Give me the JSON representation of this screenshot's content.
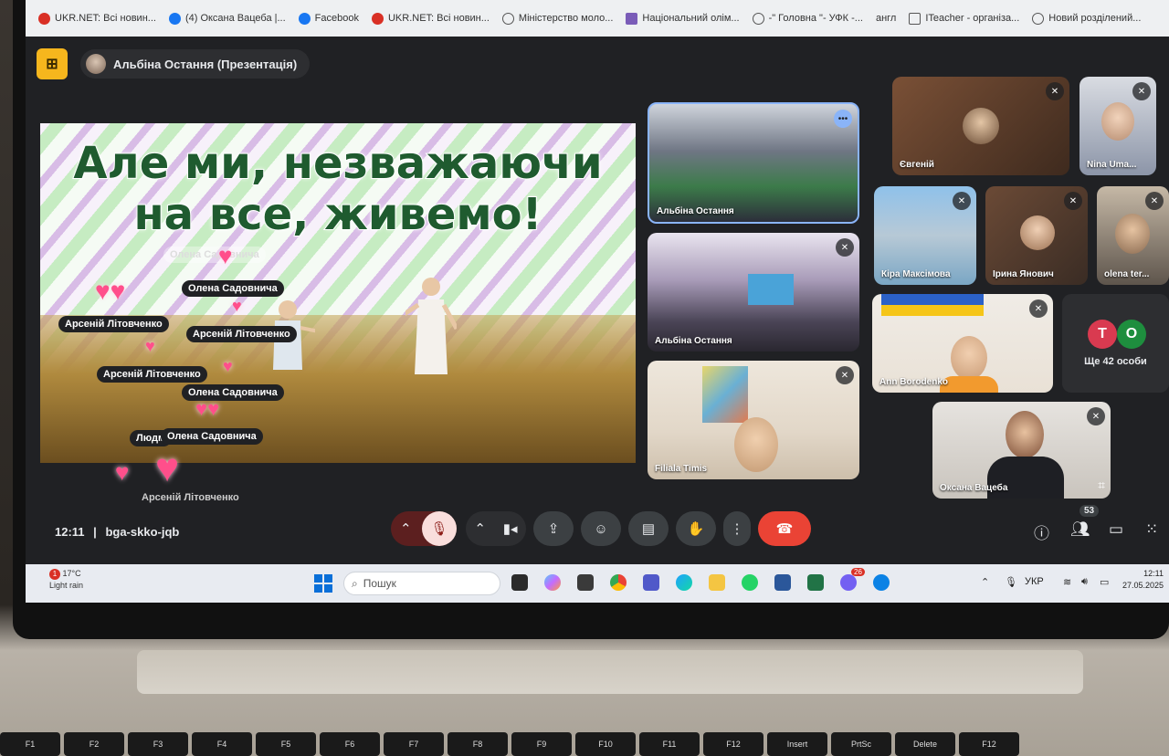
{
  "bookmarks": [
    {
      "label": "UKR.NET: Всі новин...",
      "icon": "ukrnet-icon"
    },
    {
      "label": "(4) Оксана Вацеба |...",
      "icon": "facebook-icon"
    },
    {
      "label": "Facebook",
      "icon": "facebook-icon"
    },
    {
      "label": "UKR.NET: Всі новин...",
      "icon": "ukrnet-icon"
    },
    {
      "label": "Міністерство моло...",
      "icon": "globe-icon"
    },
    {
      "label": "Національний олім...",
      "icon": "globe-icon"
    },
    {
      "label": "-\" Головна \"- УФК -...",
      "icon": "globe-icon"
    },
    {
      "label": "англ",
      "icon": ""
    },
    {
      "label": "ITeacher - організа...",
      "icon": "page-icon"
    },
    {
      "label": "Новий розділений...",
      "icon": "globe-icon"
    }
  ],
  "presenter": {
    "name": "Альбіна Остання (Презентація)"
  },
  "slide": {
    "title_line1": "Але ми, незважаючи",
    "title_line2": "на все, живемо!",
    "reactions": [
      "Олена Садовнича",
      "Арсеній Літовченко",
      "Арсеній Літовченко",
      "Арсеній Літовченко",
      "Олена Садовнича",
      "Олена Садовнича",
      "Людм",
      "Арсеній Літовченко"
    ]
  },
  "tiles": {
    "albina1": "Альбіна Остання",
    "albina2": "Альбіна Остання",
    "filiala": "Filiala Timis",
    "yevhenii": "Євгеній",
    "nina": "Nina Uma...",
    "kira": "Кіра Максімова",
    "iryna": "Ірина Янович",
    "olena": "olena ter...",
    "ann": "Ann Borodenko",
    "more_initial1": "T",
    "more_initial2": "O",
    "more_label": "Ще 42 особи",
    "oksana": "Оксана Вацеба"
  },
  "controls": {
    "time": "12:11",
    "separator": "|",
    "meeting_code": "bga-skko-jqb",
    "participants_count": "53"
  },
  "taskbar": {
    "weather_temp": "17°C",
    "weather_desc": "Light rain",
    "weather_alert": "1",
    "search_placeholder": "Пошук",
    "lang": "УКР",
    "time": "12:11",
    "date": "27.05.2025",
    "viber_badge": "26"
  },
  "keyboard": [
    "F1",
    "F2",
    "F3",
    "F4",
    "F5",
    "F6",
    "F7",
    "F8",
    "F9",
    "F10",
    "F11",
    "F12",
    "Insert",
    "PrtSc",
    "Delete",
    "F12"
  ],
  "colors": {
    "meet_bg": "#202124",
    "end_call": "#ea4335",
    "tile_highlight": "#8ab4f8",
    "badge_yellow": "#f6b61d"
  }
}
